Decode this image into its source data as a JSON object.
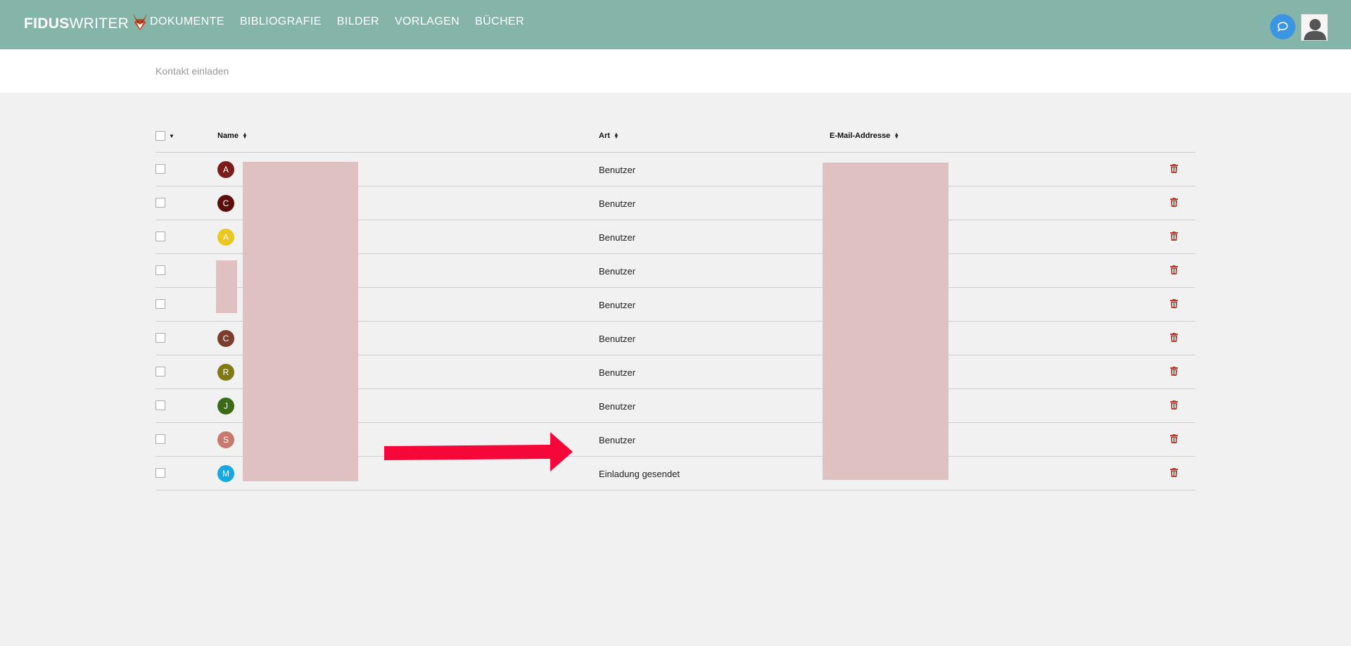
{
  "header": {
    "logo_bold": "FIDUS",
    "logo_light": "WRITER",
    "nav": [
      "DOKUMENTE",
      "BIBLIOGRAFIE",
      "BILDER",
      "VORLAGEN",
      "BÜCHER"
    ]
  },
  "subbar": {
    "invite_label": "Kontakt einladen"
  },
  "table": {
    "columns": {
      "name": "Name",
      "type": "Art",
      "email": "E-Mail-Addresse"
    },
    "rows": [
      {
        "initial": "A",
        "color": "#7a1c1c",
        "type": "Benutzer"
      },
      {
        "initial": "C",
        "color": "#5b0e0e",
        "type": "Benutzer"
      },
      {
        "initial": "A",
        "color": "#e8c81e",
        "type": "Benutzer"
      },
      {
        "initial": "",
        "color": "",
        "type": "Benutzer"
      },
      {
        "initial": "",
        "color": "",
        "type": "Benutzer"
      },
      {
        "initial": "C",
        "color": "#7b3e2e",
        "type": "Benutzer"
      },
      {
        "initial": "R",
        "color": "#7e7a16",
        "type": "Benutzer"
      },
      {
        "initial": "J",
        "color": "#3d6a16",
        "type": "Benutzer"
      },
      {
        "initial": "S",
        "color": "#c87a70",
        "type": "Benutzer"
      },
      {
        "initial": "M",
        "color": "#18a8e0",
        "type": "Einladung gesendet"
      }
    ]
  },
  "colors": {
    "header": "#85b4a8",
    "trash": "#c0392b",
    "arrow": "#f5073a",
    "redaction": "#dfc1c2"
  }
}
